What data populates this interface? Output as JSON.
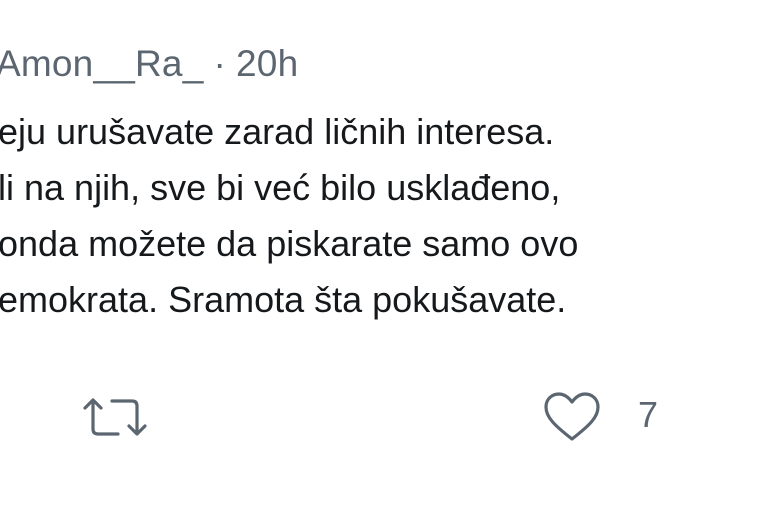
{
  "tweet": {
    "username": "Amon__Ra_",
    "separator": "·",
    "time": "20h",
    "lines": [
      "eju urušavate zarad ličnih interesa.",
      "li na njih, sve bi već bilo usklađeno,",
      "onda možete da piskarate samo ovo",
      "emokrata. Sramota šta pokušavate."
    ]
  },
  "actions": {
    "retweet_icon": "retweet-icon",
    "like_icon": "heart-icon",
    "like_count": "7"
  },
  "colors": {
    "text": "#16191c",
    "muted": "#5b6670",
    "background": "#ffffff"
  }
}
